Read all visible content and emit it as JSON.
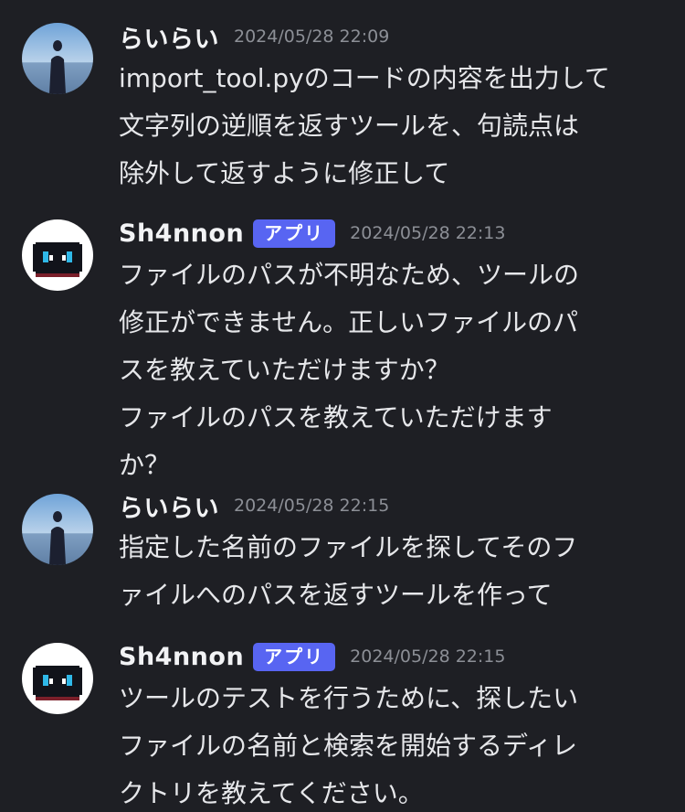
{
  "messages": [
    {
      "username": "らいらい",
      "timestamp": "2024/05/28 22:09",
      "lines": [
        "import_tool.pyのコードの内容を出力して",
        "文字列の逆順を返すツールを、句読点は",
        "除外して返すように修正して"
      ]
    },
    {
      "username": "Sh4nnon",
      "badge": "アプリ",
      "timestamp": "2024/05/28 22:13",
      "lines": [
        "ファイルのパスが不明なため、ツールの",
        "修正ができません。正しいファイルのパ",
        "スを教えていただけますか？",
        "ファイルのパスを教えていただけます",
        "か？"
      ]
    },
    {
      "username": "らいらい",
      "timestamp": "2024/05/28 22:15",
      "lines": [
        "指定した名前のファイルを探してそのフ",
        "ァイルへのパスを返すツールを作って"
      ]
    },
    {
      "username": "Sh4nnon",
      "badge": "アプリ",
      "timestamp": "2024/05/28 22:15",
      "lines": [
        "ツールのテストを行うために、探したい",
        "ファイルの名前と検索を開始するディレ",
        "クトリを教えてください。"
      ]
    }
  ],
  "colors": {
    "background": "#1e1f24",
    "badge": "#5865f2",
    "timestamp": "#8c8f96"
  },
  "icons": {
    "user_avatar": "person-on-beach-avatar",
    "bot_avatar": "pixel-robot-avatar"
  }
}
